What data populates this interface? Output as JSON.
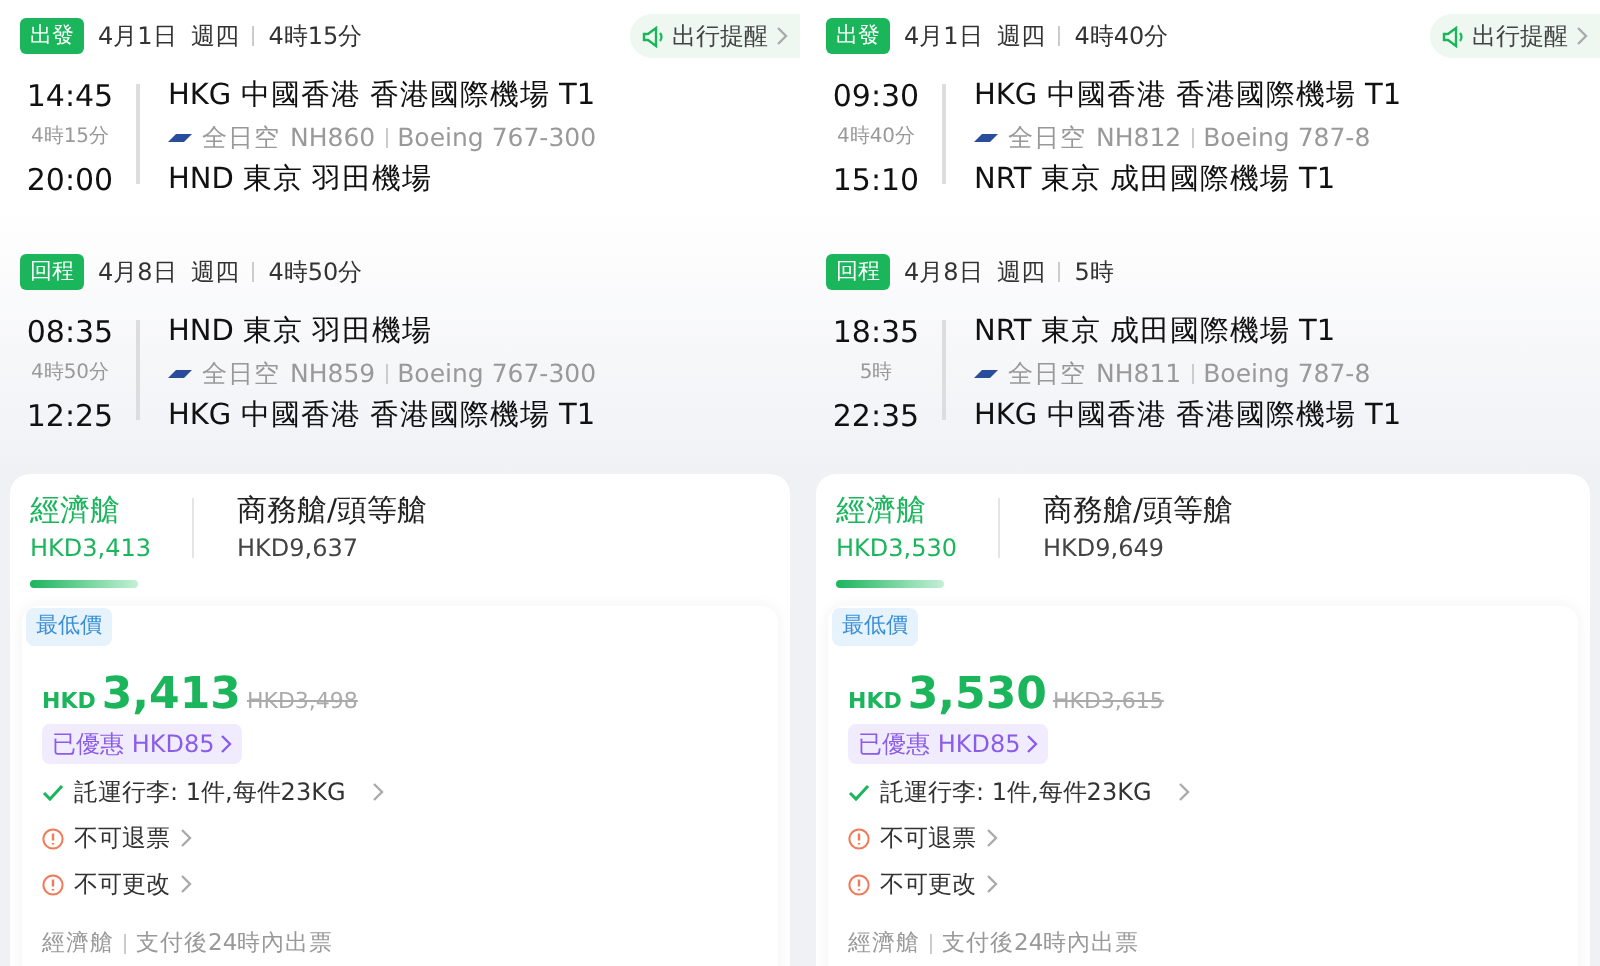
{
  "panels": [
    {
      "reminder": "出行提醒",
      "legs": [
        {
          "tag": "出發",
          "date": "4月1日",
          "weekday": "週四",
          "duration": "4時15分",
          "dep_time": "14:45",
          "flight_duration": "4時15分",
          "arr_time": "20:00",
          "from": "HKG 中國香港 香港國際機場 T1",
          "airline": "全日空",
          "flight": "NH860",
          "aircraft": "Boeing 767-300",
          "to": "HND 東京 羽田機場"
        },
        {
          "tag": "回程",
          "date": "4月8日",
          "weekday": "週四",
          "duration": "4時50分",
          "dep_time": "08:35",
          "flight_duration": "4時50分",
          "arr_time": "12:25",
          "from": "HND 東京 羽田機場",
          "airline": "全日空",
          "flight": "NH859",
          "aircraft": "Boeing 767-300",
          "to": "HKG 中國香港 香港國際機場 T1"
        }
      ],
      "cabins": [
        {
          "name": "經濟艙",
          "price": "HKD3,413",
          "selected": true
        },
        {
          "name": "商務艙/頭等艙",
          "price": "HKD9,637",
          "selected": false
        }
      ],
      "fare": {
        "badge": "最低價",
        "currency": "HKD",
        "price": "3,413",
        "original_price": "HKD3,498",
        "discount": "已優惠 HKD85",
        "features": [
          {
            "kind": "included",
            "text": "託運行李: 1件,每件23KG"
          },
          {
            "kind": "warning",
            "text": "不可退票"
          },
          {
            "kind": "warning",
            "text": "不可更改"
          }
        ],
        "cabin": "經濟艙",
        "ticketing": "支付後24時內出票"
      }
    },
    {
      "reminder": "出行提醒",
      "legs": [
        {
          "tag": "出發",
          "date": "4月1日",
          "weekday": "週四",
          "duration": "4時40分",
          "dep_time": "09:30",
          "flight_duration": "4時40分",
          "arr_time": "15:10",
          "from": "HKG 中國香港 香港國際機場 T1",
          "airline": "全日空",
          "flight": "NH812",
          "aircraft": "Boeing 787-8",
          "to": "NRT 東京 成田國際機場 T1"
        },
        {
          "tag": "回程",
          "date": "4月8日",
          "weekday": "週四",
          "duration": "5時",
          "dep_time": "18:35",
          "flight_duration": "5時",
          "arr_time": "22:35",
          "from": "NRT 東京 成田國際機場 T1",
          "airline": "全日空",
          "flight": "NH811",
          "aircraft": "Boeing 787-8",
          "to": "HKG 中國香港 香港國際機場 T1"
        }
      ],
      "cabins": [
        {
          "name": "經濟艙",
          "price": "HKD3,530",
          "selected": true
        },
        {
          "name": "商務艙/頭等艙",
          "price": "HKD9,649",
          "selected": false
        }
      ],
      "fare": {
        "badge": "最低價",
        "currency": "HKD",
        "price": "3,530",
        "original_price": "HKD3,615",
        "discount": "已優惠 HKD85",
        "features": [
          {
            "kind": "included",
            "text": "託運行李: 1件,每件23KG"
          },
          {
            "kind": "warning",
            "text": "不可退票"
          },
          {
            "kind": "warning",
            "text": "不可更改"
          }
        ],
        "cabin": "經濟艙",
        "ticketing": "支付後24時內出票"
      }
    }
  ]
}
